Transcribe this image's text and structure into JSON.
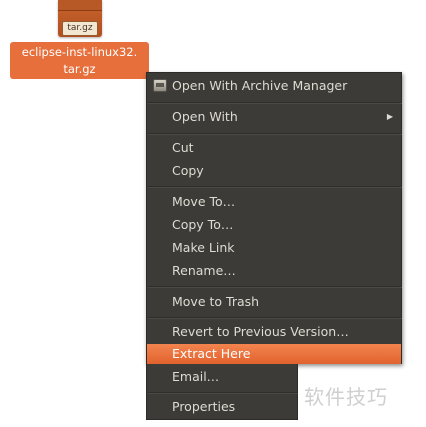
{
  "desktop": {
    "file": {
      "icon_tag": "tar.gz",
      "label_line1": "eclipse-inst-linux32.",
      "label_line2": "tar.gz"
    }
  },
  "context_menu": {
    "items": [
      {
        "label": "Open With Archive Manager",
        "icon": "archive-manager-icon"
      },
      {
        "label": "Open With",
        "has_submenu": true
      },
      {
        "label": "Cut"
      },
      {
        "label": "Copy"
      },
      {
        "label": "Move To…"
      },
      {
        "label": "Copy To…"
      },
      {
        "label": "Make Link"
      },
      {
        "label": "Rename…"
      },
      {
        "label": "Move to Trash"
      },
      {
        "label": "Revert to Previous Version…"
      },
      {
        "label": "Extract Here",
        "highlighted": true
      },
      {
        "label": "Email…"
      },
      {
        "label": "Properties"
      }
    ],
    "highlight_color": "#f07746",
    "background_color": "#3c3b37",
    "submenu_arrow": "▶"
  },
  "watermark": "软件技巧"
}
